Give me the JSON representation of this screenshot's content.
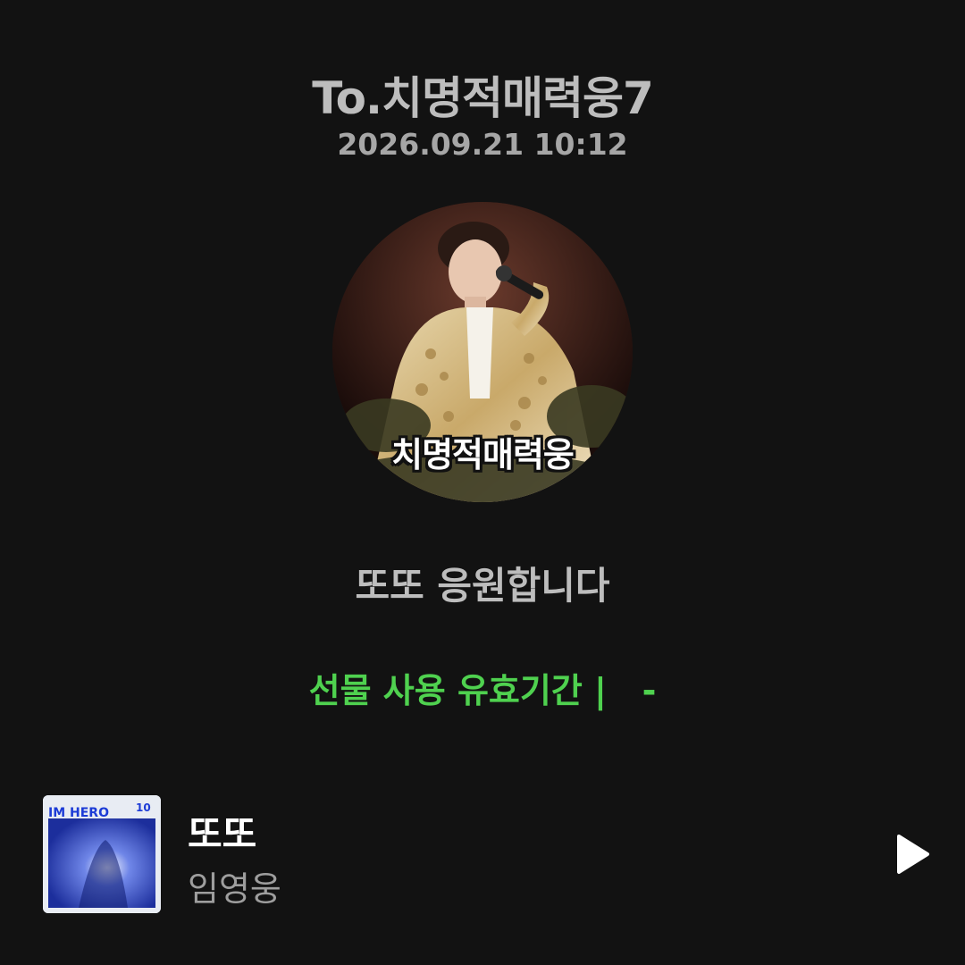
{
  "header": {
    "title": "To.치명적매력웅7",
    "date": "2026.09.21 10:12"
  },
  "avatar": {
    "caption": "치명적매력웅"
  },
  "message": "또또 응원합니다",
  "gift": {
    "validity": "선물 사용 유효기간 |   -"
  },
  "song": {
    "title": "또또",
    "artist": "임영웅",
    "album_text": "IM HERO",
    "album_number": "10"
  },
  "colors": {
    "background": "#121212",
    "accent_green": "#4fd14f",
    "text_gray": "#bdbdbd"
  },
  "icons": {
    "play": "play-icon"
  }
}
